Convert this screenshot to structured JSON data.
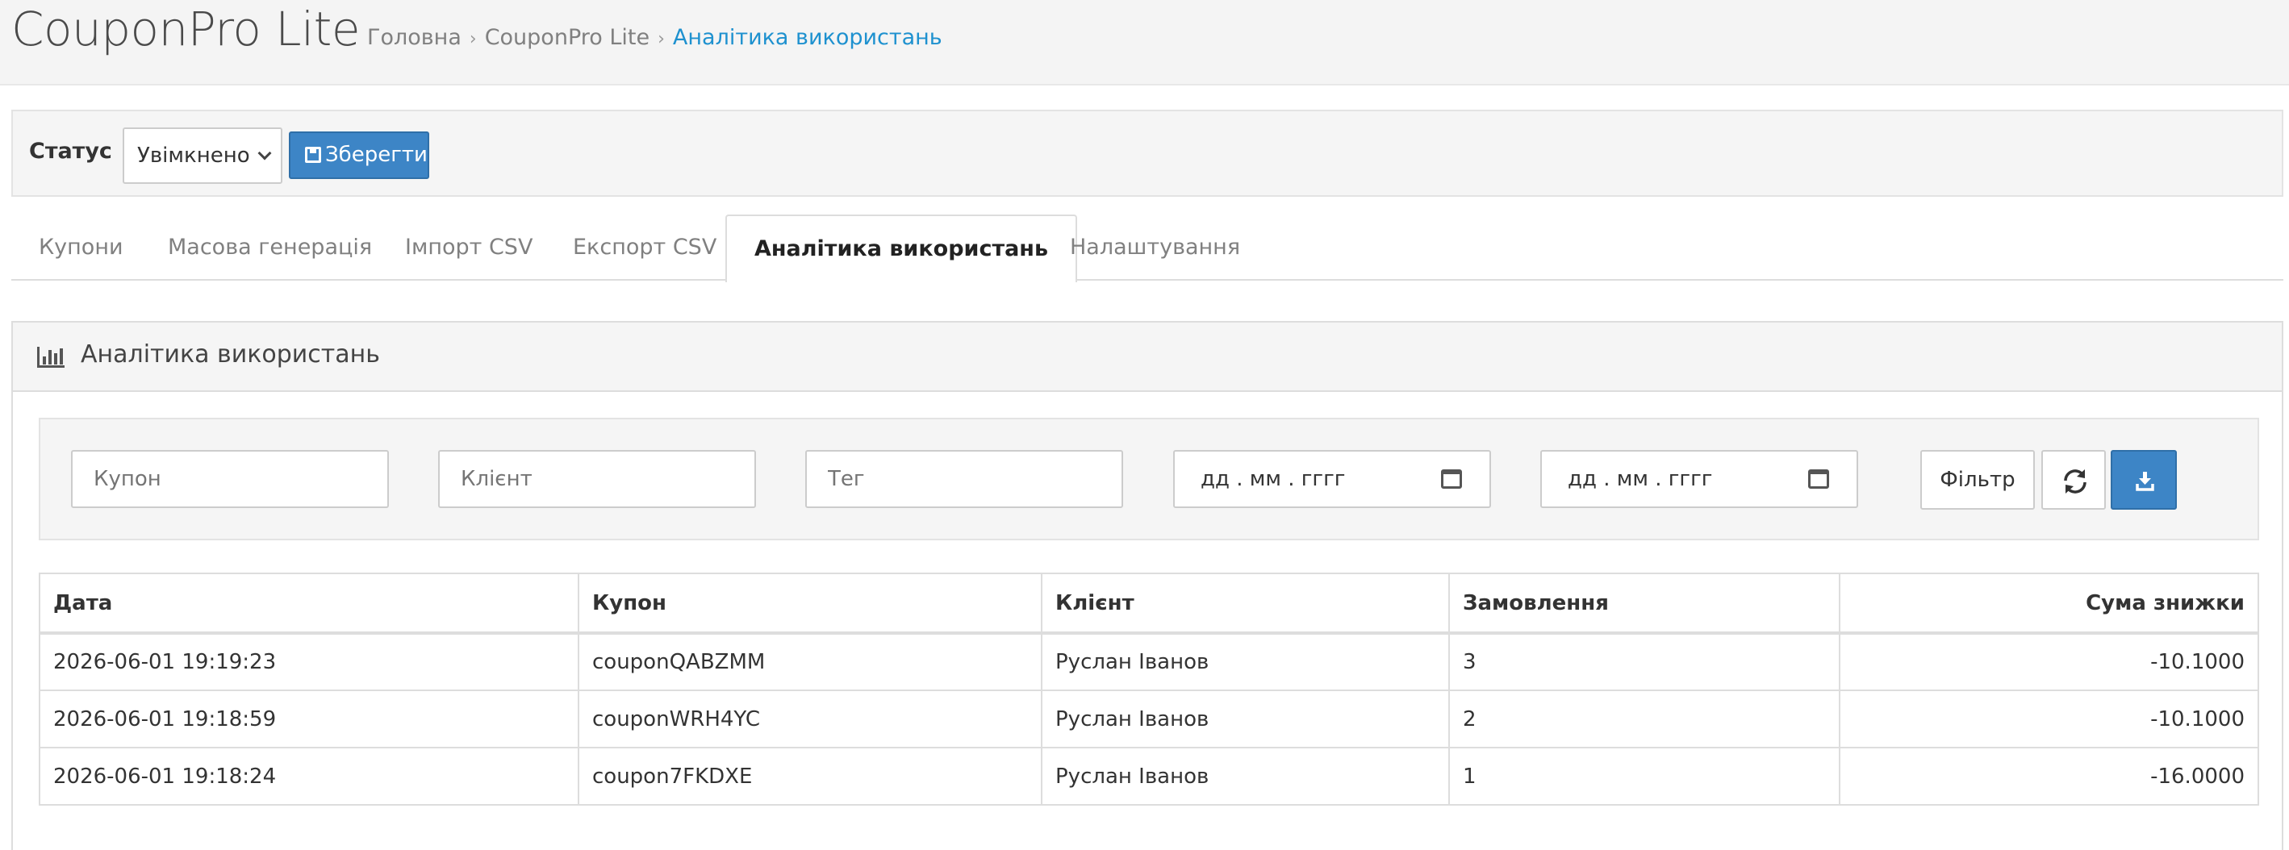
{
  "header": {
    "title": "CouponPro Lite",
    "breadcrumb": [
      "Головна",
      "CouponPro Lite",
      "Аналітика використань"
    ]
  },
  "status": {
    "label": "Статус",
    "value": "Увімкнено",
    "save_label": "Зберегти"
  },
  "tabs": [
    {
      "label": "Купони"
    },
    {
      "label": "Масова генерація"
    },
    {
      "label": "Імпорт CSV"
    },
    {
      "label": "Експорт CSV"
    },
    {
      "label": "Аналітика використань",
      "active": true
    },
    {
      "label": "Налаштування"
    }
  ],
  "panel": {
    "title": "Аналітика використань",
    "icon": "bar-chart-icon"
  },
  "filters": {
    "coupon_placeholder": "Купон",
    "customer_placeholder": "Клієнт",
    "tag_placeholder": "Тег",
    "date_from_placeholder": "дд . мм . гггг",
    "date_to_placeholder": "дд . мм . гггг",
    "filter_label": "Фільтр"
  },
  "table": {
    "columns": [
      "Дата",
      "Купон",
      "Клієнт",
      "Замовлення",
      "Сума знижки"
    ],
    "rows": [
      [
        "2026-06-01 19:19:23",
        "couponQABZMM",
        "Руслан Іванов",
        "3",
        "-10.1000"
      ],
      [
        "2026-06-01 19:18:59",
        "couponWRH4YC",
        "Руслан Іванов",
        "2",
        "-10.1000"
      ],
      [
        "2026-06-01 19:18:24",
        "coupon7FKDXE",
        "Руслан Іванов",
        "1",
        "-16.0000"
      ]
    ]
  },
  "colors": {
    "accent": "#3d85c6",
    "breadcrumb_active": "#1e91cf"
  }
}
